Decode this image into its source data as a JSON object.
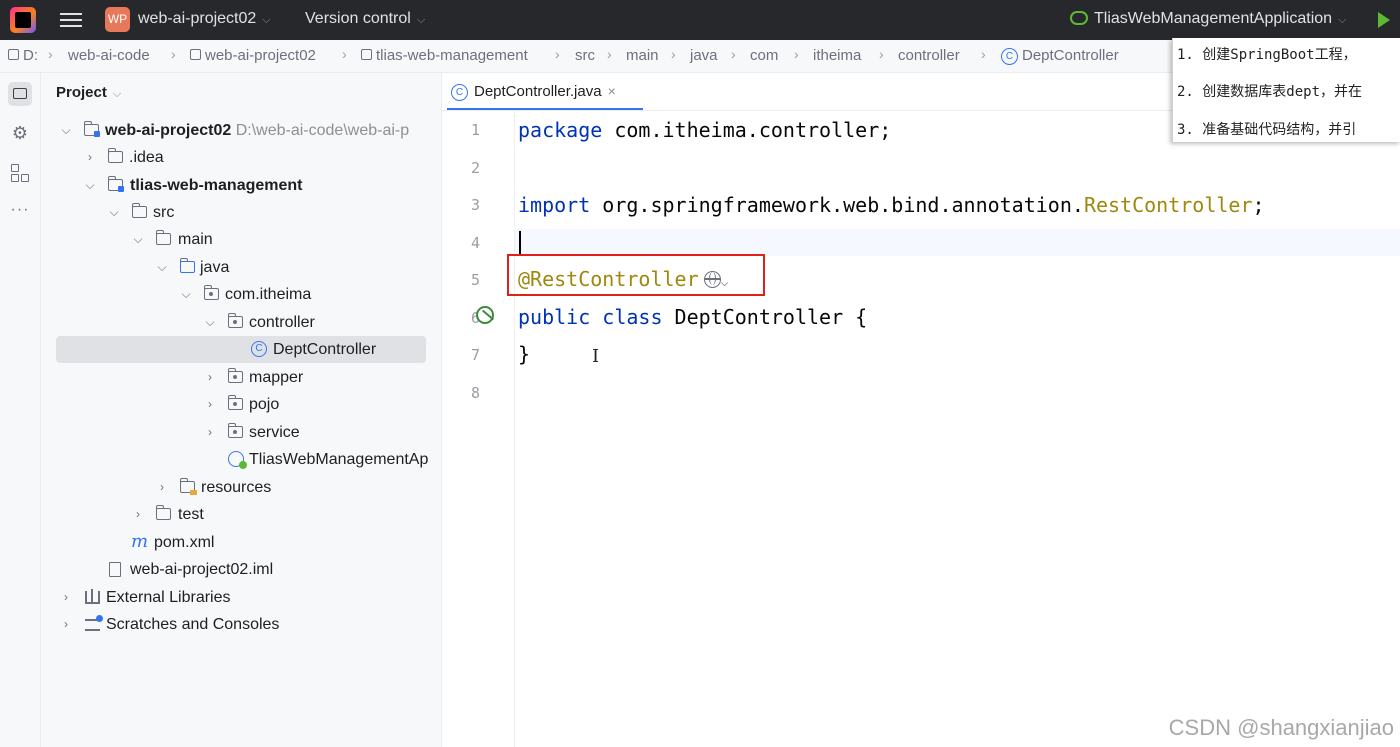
{
  "titlebar": {
    "project_badge": "WP",
    "project_name": "web-ai-project02",
    "version_control": "Version control",
    "run_config": "TliasWebManagementApplication"
  },
  "breadcrumb": [
    "D:",
    "web-ai-code",
    "web-ai-project02",
    "tlias-web-management",
    "src",
    "main",
    "java",
    "com",
    "itheima",
    "controller",
    "DeptController"
  ],
  "note": {
    "lines": [
      "1. 创建SpringBoot工程，",
      "2. 创建数据库表dept，并在",
      "3. 准备基础代码结构，并引"
    ]
  },
  "toolstrip": {
    "more": "···"
  },
  "project_panel": {
    "title": "Project",
    "tree": [
      {
        "label": "web-ai-project02",
        "suffix": "D:\\web-ai-code\\web-ai-p"
      },
      {
        "label": ".idea"
      },
      {
        "label": "tlias-web-management"
      },
      {
        "label": "src"
      },
      {
        "label": "main"
      },
      {
        "label": "java"
      },
      {
        "label": "com.itheima"
      },
      {
        "label": "controller"
      },
      {
        "label": "DeptController"
      },
      {
        "label": "mapper"
      },
      {
        "label": "pojo"
      },
      {
        "label": "service"
      },
      {
        "label": "TliasWebManagementAp"
      },
      {
        "label": "resources"
      },
      {
        "label": "test"
      },
      {
        "label": "pom.xml"
      },
      {
        "label": "web-ai-project02.iml"
      },
      {
        "label": "External Libraries"
      },
      {
        "label": "Scratches and Consoles"
      }
    ]
  },
  "editor": {
    "tab_label": "DeptController.java",
    "line_numbers": [
      "1",
      "2",
      "3",
      "4",
      "5",
      "6",
      "7",
      "8"
    ],
    "code": {
      "l1_kw": "package",
      "l1_rest": " com.itheima.controller;",
      "l3_kw": "import",
      "l3_rest": " org.springframework.web.bind.annotation.",
      "l3_ann": "RestController",
      "l3_end": ";",
      "l5_ann": "@RestController",
      "l6_kw": "public class",
      "l6_rest": " DeptController {",
      "l7": "}"
    }
  },
  "watermark": "CSDN @shangxianjiao"
}
